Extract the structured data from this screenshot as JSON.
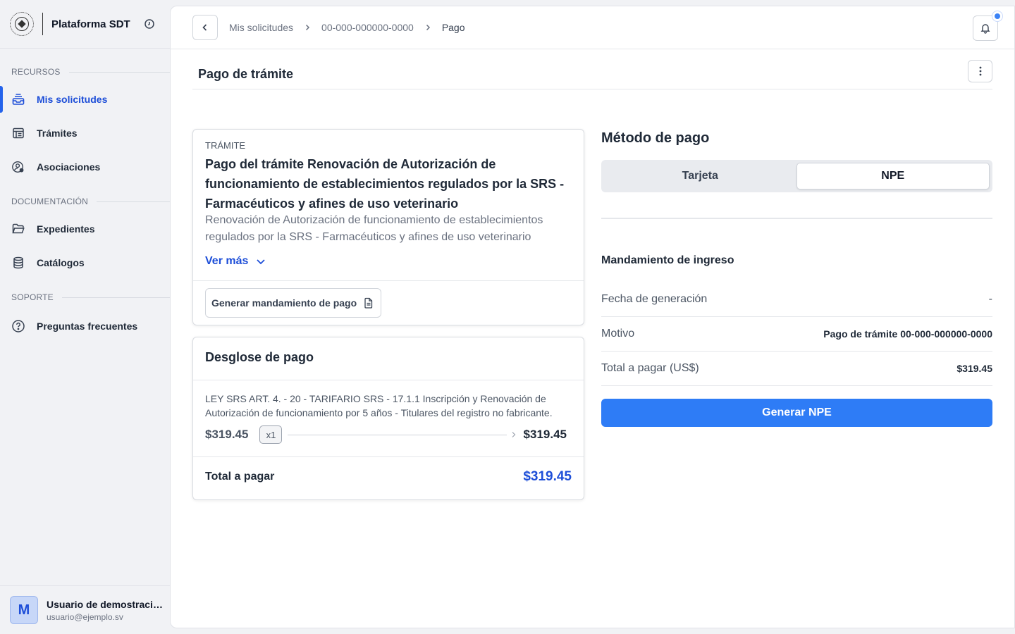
{
  "app": {
    "brand_name": "Plataforma SDT"
  },
  "sidebar": {
    "sections": [
      {
        "label": "RECURSOS",
        "items": [
          {
            "label": "Mis solicitudes",
            "icon": "inbox-stack-icon",
            "active": true
          },
          {
            "label": "Trámites",
            "icon": "calendar-table-icon",
            "active": false
          },
          {
            "label": "Asociaciones",
            "icon": "user-gear-icon",
            "active": false
          }
        ]
      },
      {
        "label": "DOCUMENTACIÓN",
        "items": [
          {
            "label": "Expedientes",
            "icon": "folder-open-icon",
            "active": false
          },
          {
            "label": "Catálogos",
            "icon": "database-icon",
            "active": false
          }
        ]
      },
      {
        "label": "SOPORTE",
        "items": [
          {
            "label": "Preguntas frecuentes",
            "icon": "question-circle-icon",
            "active": false
          }
        ]
      }
    ],
    "user": {
      "initial": "M",
      "name": "Usuario de demostración",
      "email": "usuario@ejemplo.sv"
    }
  },
  "header": {
    "breadcrumbs": [
      "Mis solicitudes",
      "00-000-000000-0000",
      "Pago"
    ]
  },
  "page": {
    "title": "Pago de trámite"
  },
  "tramite_card": {
    "label": "TRÁMITE",
    "title": "Pago del trámite Renovación de Autorización de funcionamiento de establecimientos regulados por la SRS - Farmacéuticos y afines de uso veterinario",
    "description": "Renovación de Autorización de funcionamiento de establecimientos regulados por la SRS - Farmacéuticos y afines de uso veterinario",
    "ver_mas": "Ver más",
    "generate_button": "Generar mandamiento de pago"
  },
  "desglose": {
    "title": "Desglose de pago",
    "items": [
      {
        "concept": "LEY SRS ART. 4. - 20 - TARIFARIO SRS - 17.1.1 Inscripción y Renovación de Autorización de funcionamiento por 5 años - Titulares del registro no fabricante.",
        "unit_price": "$319.45",
        "quantity": "x1",
        "subtotal": "$319.45"
      }
    ],
    "total_label": "Total a pagar",
    "total_value": "$319.45"
  },
  "payment": {
    "title": "Método de pago",
    "options": [
      "Tarjeta",
      "NPE"
    ],
    "selected": "NPE",
    "mandamiento_title": "Mandamiento de ingreso",
    "rows": [
      {
        "label": "Fecha de generación",
        "value": "-"
      },
      {
        "label": "Motivo",
        "value": "Pago de trámite 00-000-000000-0000"
      },
      {
        "label": "Total a pagar (US$)",
        "value": "$319.45"
      }
    ],
    "generate_button": "Generar NPE"
  },
  "colors": {
    "accent": "#2563eb",
    "primary_button": "#2e7cf6",
    "notification_dot": "#3b82f6"
  }
}
